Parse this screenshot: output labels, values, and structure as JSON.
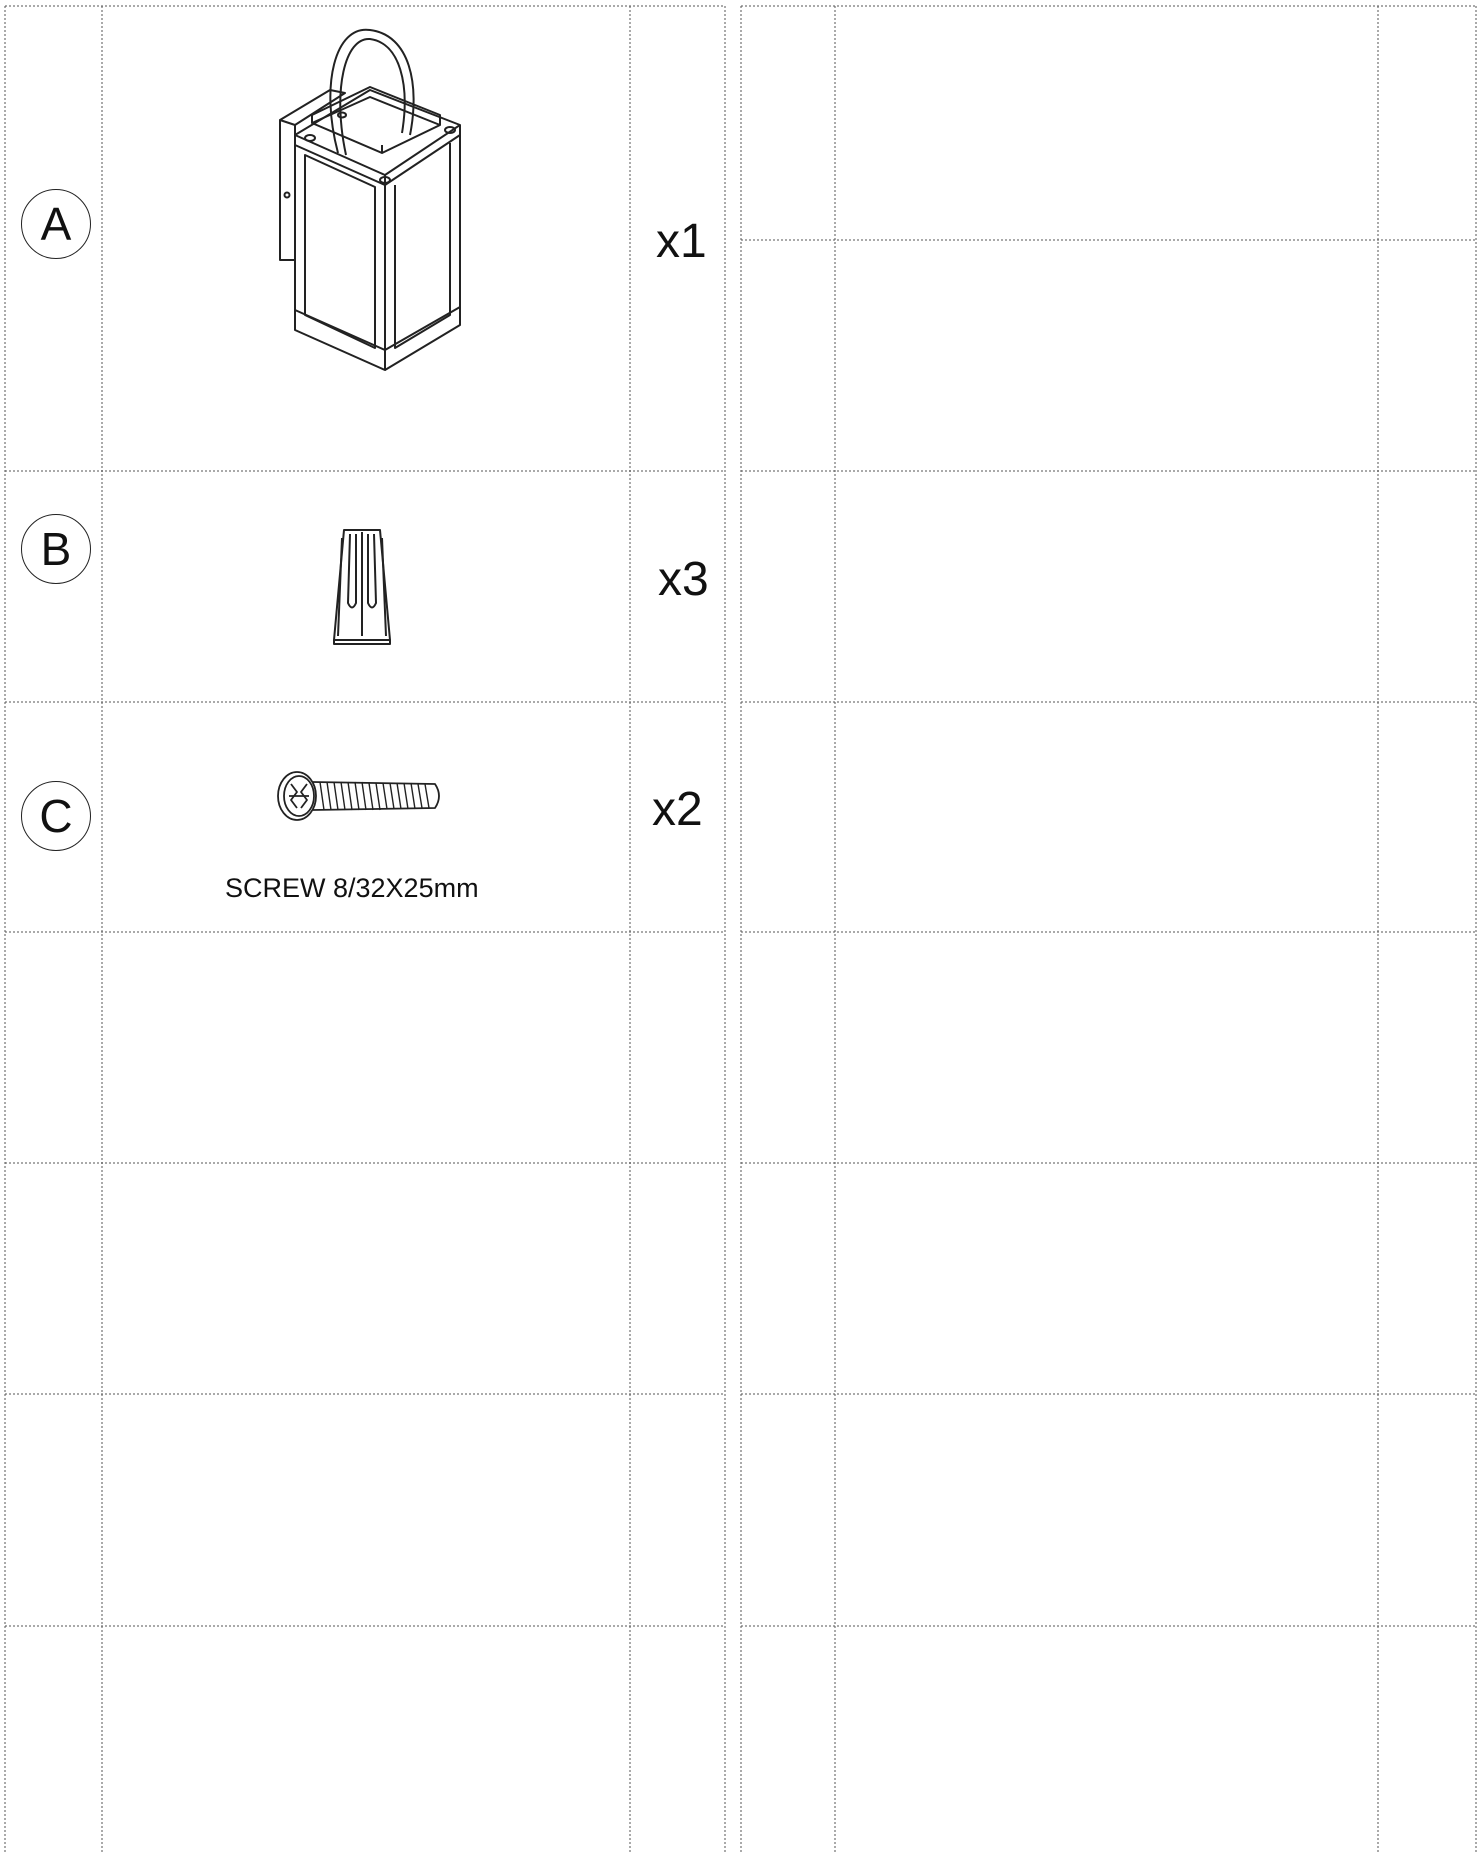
{
  "parts": [
    {
      "letter": "A",
      "quantity": "x1",
      "icon": "wall-lantern-icon",
      "caption": ""
    },
    {
      "letter": "B",
      "quantity": "x3",
      "icon": "wire-nut-icon",
      "caption": ""
    },
    {
      "letter": "C",
      "quantity": "x2",
      "icon": "screw-icon",
      "caption": "SCREW 8/32X25mm"
    }
  ],
  "colors": {
    "line": "#222222",
    "grid": "#555555",
    "background": "#ffffff"
  }
}
